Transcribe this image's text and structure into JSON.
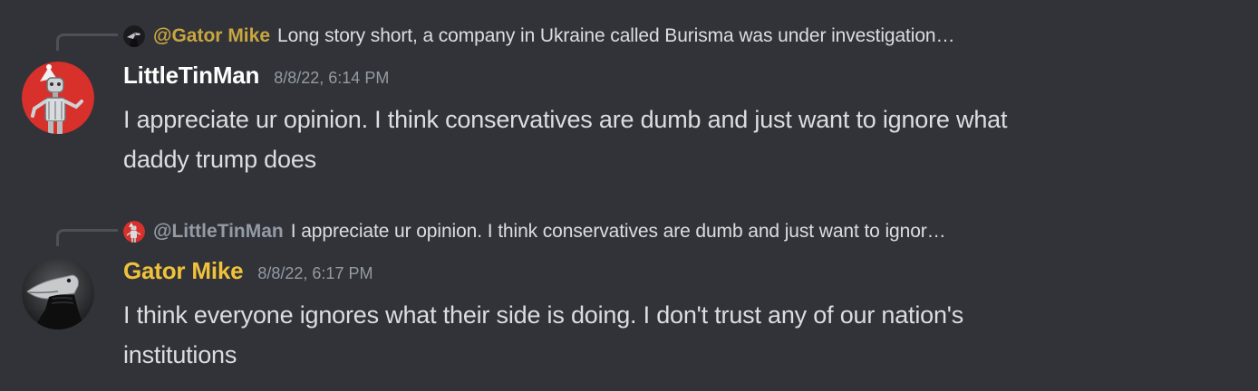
{
  "colors": {
    "background": "#313338",
    "text": "#dbdee1",
    "muted": "#949ba4",
    "gator_name": "#f0c13b",
    "gator_reply_name": "#c9a640",
    "littletinman_name": "#ffffff",
    "avatar_red": "#d8312b"
  },
  "messages": [
    {
      "reply": {
        "author": "@Gator Mike",
        "preview": "Long story short, a company in Ukraine called Burisma was under investigation…",
        "avatar_icon": "alligator-icon"
      },
      "avatar_icon": "robot-tinman-icon",
      "username": "LittleTinMan",
      "timestamp": "8/8/22, 6:14 PM",
      "content_line_1": "I appreciate ur opinion. I think conservatives are dumb and just want to ignore what",
      "content_line_2": "daddy trump does"
    },
    {
      "reply": {
        "author": "@LittleTinMan",
        "preview": "I appreciate ur opinion. I think conservatives are dumb and just want to ignor…",
        "avatar_icon": "robot-tinman-icon"
      },
      "avatar_icon": "alligator-icon",
      "username": "Gator Mike",
      "timestamp": "8/8/22, 6:17 PM",
      "content_line_1": "I think everyone ignores what their side is doing. I don't trust any of our nation's",
      "content_line_2": "institutions"
    }
  ]
}
